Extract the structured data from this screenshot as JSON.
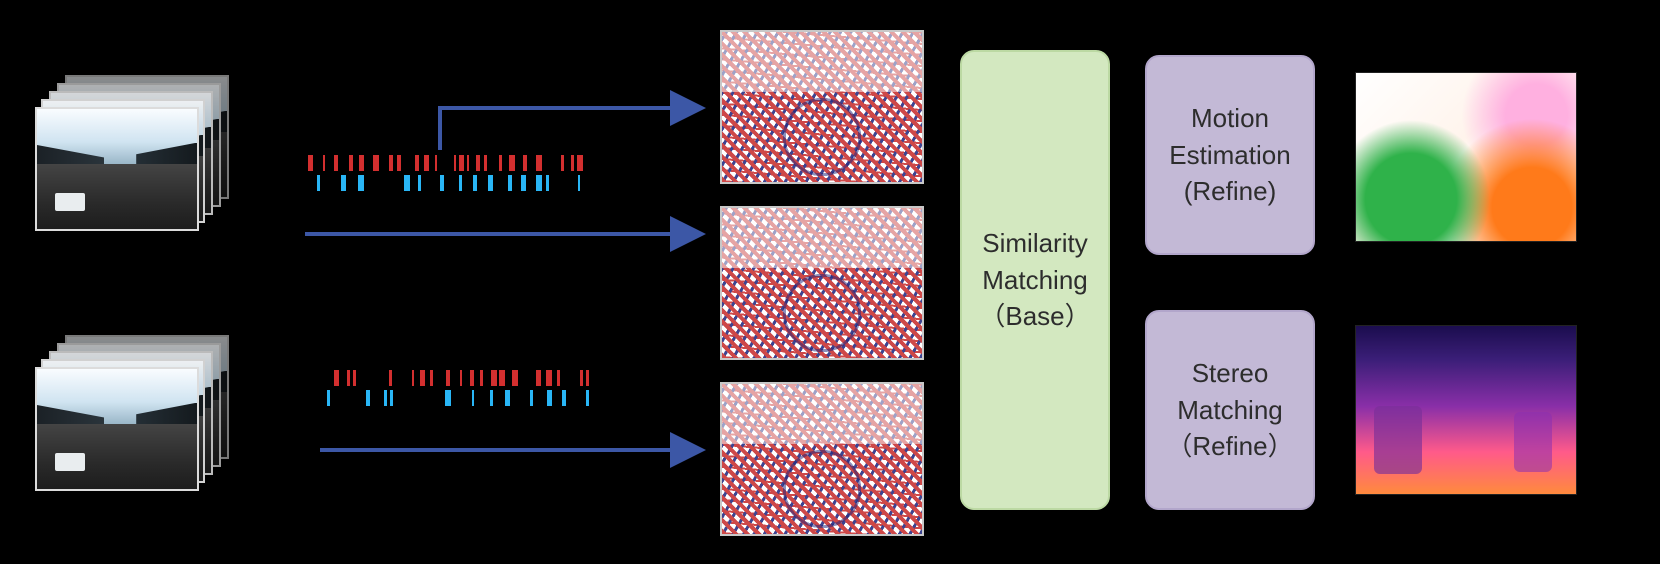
{
  "inputs": {
    "top_stack_semantic": "temporal-frame-stack-top",
    "bottom_stack_semantic": "temporal-frame-stack-bottom"
  },
  "events": {
    "top_colors": {
      "row1": "red",
      "row2": "cyan"
    },
    "bottom_colors": {
      "row1": "red",
      "row2": "cyan"
    }
  },
  "features": {
    "count": 3,
    "palette": [
      "red",
      "blue",
      "white"
    ]
  },
  "blocks": {
    "similarity": {
      "line1": "Similarity",
      "line2": "Matching",
      "line3": "（Base）"
    },
    "motion": {
      "line1": "Motion",
      "line2": "Estimation",
      "line3": "(Refine)"
    },
    "stereo": {
      "line1": "Stereo",
      "line2": "Matching",
      "line3": "（Refine）"
    }
  },
  "outputs": {
    "top_semantic": "optical-flow-colormap",
    "bottom_semantic": "depth-colormap"
  },
  "arrows": {
    "stroke": "#3c57a6",
    "stroke_width": 4
  }
}
